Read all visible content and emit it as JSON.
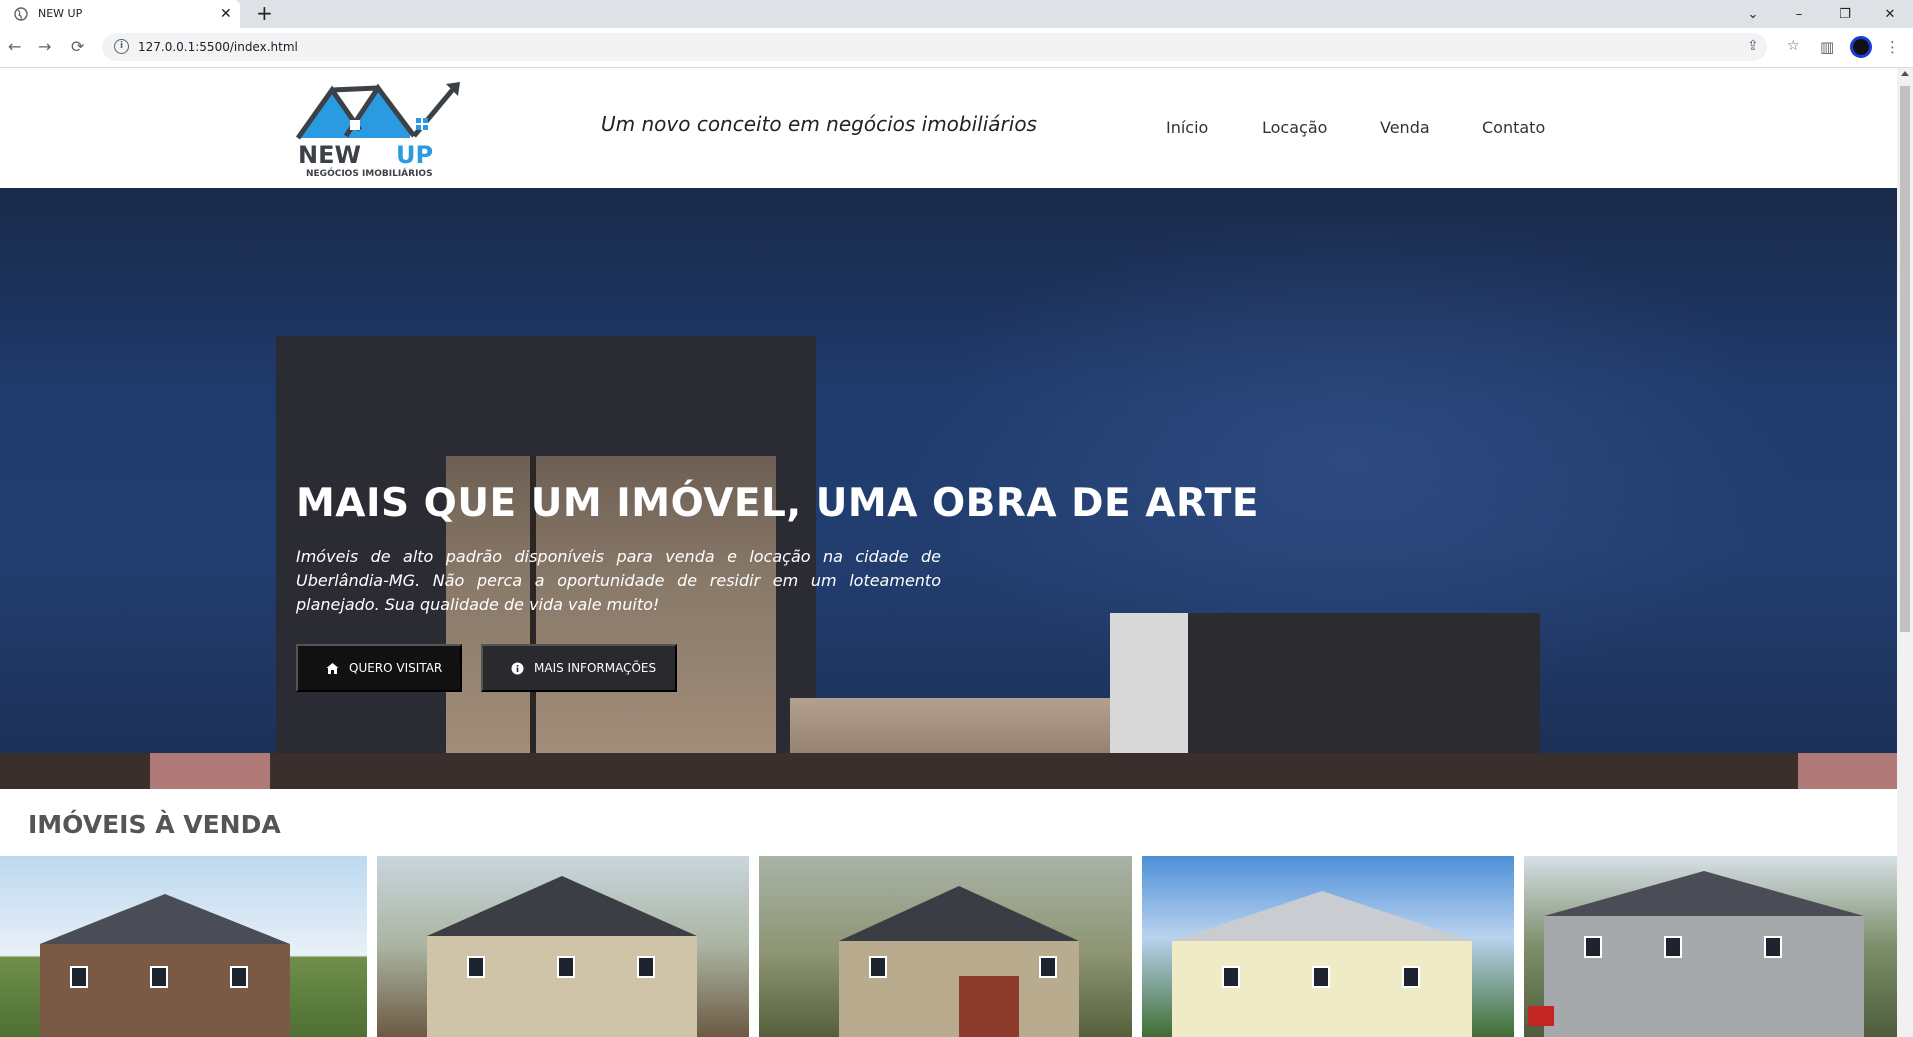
{
  "browser": {
    "tab_title": "NEW UP",
    "tab_close": "✕",
    "new_tab": "+",
    "url": "127.0.0.1:5500/index.html",
    "controls": {
      "dropdown": "⌄",
      "minimize": "–",
      "restore": "❐",
      "close": "✕"
    },
    "nav": {
      "back": "←",
      "forward": "→",
      "reload": "⟳"
    },
    "icons": {
      "share": "⇪",
      "bookmark": "☆",
      "sidepanel": "▥",
      "menu": "⋮",
      "info": "i"
    }
  },
  "header": {
    "logo": {
      "brand": "NEW UP",
      "subtitle": "NEGÓCIOS IMOBILIÁRIOS",
      "colors": {
        "roof": "#2a9be0",
        "dark": "#3c4148"
      }
    },
    "tagline": "Um novo conceito em negócios imobiliários",
    "nav": [
      "Início",
      "Locação",
      "Venda",
      "Contato"
    ]
  },
  "hero": {
    "title": "MAIS QUE UM IMÓVEL, UMA OBRA DE ARTE",
    "text": "Imóveis de alto padrão disponíveis para venda e locação na cidade de Uberlândia-MG. Não perca a oportunidade de residir em um loteamento planejado. Sua qualidade de vida vale muito!",
    "buttons": [
      {
        "label": "QUERO VISITAR",
        "icon": "house-icon"
      },
      {
        "label": "MAIS INFORMAÇÕES",
        "icon": "info-icon"
      }
    ]
  },
  "listings": {
    "title": "IMÓVEIS À VENDA"
  },
  "colors": {
    "hero_bg": "#1f3b6d",
    "button_bg": "#111111",
    "text_dark": "#333333"
  }
}
